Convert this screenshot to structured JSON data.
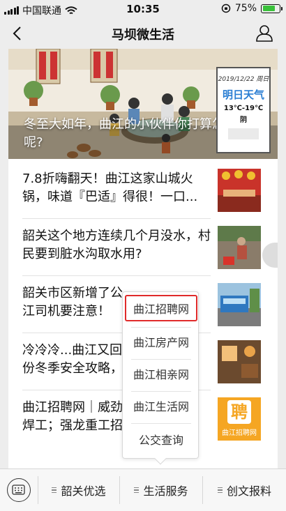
{
  "status_bar": {
    "carrier": "中国联通",
    "time": "10:35",
    "battery_percent": "75%",
    "battery_level": 0.75,
    "battery_color": "#39c13a"
  },
  "nav": {
    "title": "马坝微生活",
    "back_icon": "chevron-left-icon",
    "profile_icon": "user-icon"
  },
  "hero": {
    "caption": "冬至大如年，曲江的小伙伴你打算怎么过呢?",
    "weather_card": {
      "date": "2019/12/22  周日",
      "title": "明日天气",
      "temperature": "13℃-19℃",
      "condition": "阴"
    }
  },
  "articles": [
    {
      "title": "7.8折嗨翻天！曲江这家山城火锅，味道『巴适』得很！一口...",
      "thumb": "hotpot-restaurant"
    },
    {
      "title": "韶关这个地方连续几个月没水，村民要到脏水沟取水用?",
      "thumb": "villager-water"
    },
    {
      "title": "韶关市区新增了公...江司机要注意！",
      "title_line1": "韶关市区新增了公",
      "title_line2": "江司机要注意！",
      "thumb": "bus-road"
    },
    {
      "title": "冷冷冷...曲江又回...份冬季安全攻略，",
      "title_line1": "冷冷冷...曲江又回",
      "title_line2": "份冬季安全攻略，",
      "thumb": "warm-room"
    },
    {
      "title": "曲江招聘网｜威劲...焊工；强龙重工招",
      "title_line1": "曲江招聘网｜威劲",
      "title_line2": "焊工；强龙重工招",
      "thumb": "recruit-logo",
      "thumb_text": "曲江招聘网",
      "thumb_char": "聘"
    }
  ],
  "menu": {
    "items": [
      "曲江招聘网",
      "曲江房产网",
      "曲江相亲网",
      "曲江生活网",
      "公交查询"
    ],
    "highlight_color": "#e02a2a"
  },
  "tab_bar": {
    "keyboard_icon": "keyboard-icon",
    "tabs": [
      "韶关优选",
      "生活服务",
      "创文报料"
    ]
  }
}
